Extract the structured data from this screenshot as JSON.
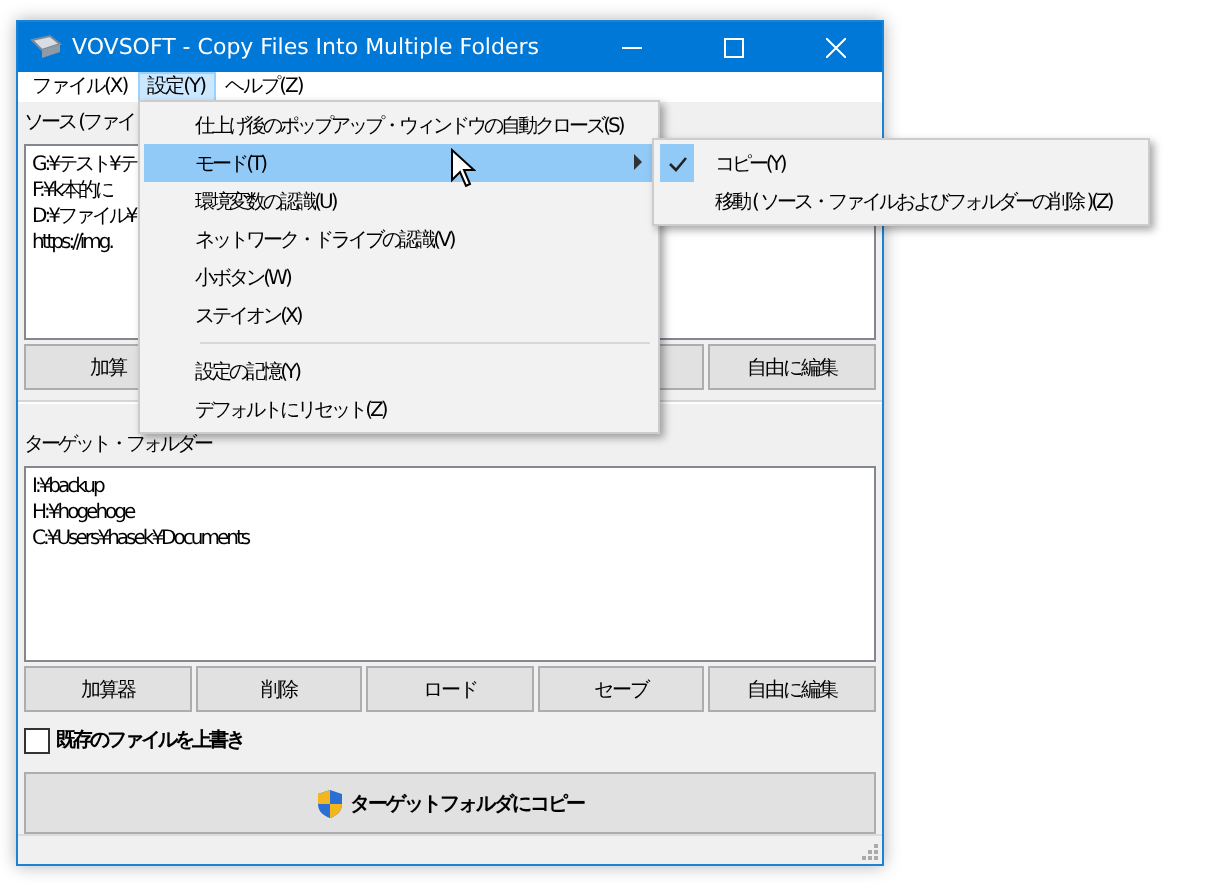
{
  "window": {
    "title": "VOVSOFT - Copy Files Into Multiple Folders"
  },
  "menu_bar": [
    {
      "label": "ファイル(X)",
      "selected": false
    },
    {
      "label": "設定(Y)",
      "selected": true
    },
    {
      "label": "ヘルプ(Z)",
      "selected": false
    }
  ],
  "source": {
    "label": "ソース (ファイ",
    "lines": [
      "G:¥テスト¥テ",
      "F:¥k本的に",
      "D:¥ファイル¥",
      "https://img."
    ],
    "buttons": [
      "加算",
      "自由に編集"
    ]
  },
  "target": {
    "label": "ターゲット・フォルダー",
    "lines": [
      "I:¥backup",
      "H:¥hogehoge",
      "C:¥Users¥hasek¥Documents"
    ],
    "buttons": [
      "加算器",
      "削除",
      "ロード",
      "セーブ",
      "自由に編集"
    ]
  },
  "overwrite": {
    "label": "既存のファイルを上書き",
    "checked": false
  },
  "copy_button": {
    "label": "ターゲットフォルダにコピー"
  },
  "settings_menu": {
    "items": [
      {
        "label": "仕上げ後のポップアップ・ウィンドウの自動クローズ(S)",
        "selected": false,
        "has_submenu": false,
        "separator_before": false
      },
      {
        "label": "モード(T)",
        "selected": true,
        "has_submenu": true,
        "separator_before": false
      },
      {
        "label": "環境変数の認識(U)",
        "selected": false,
        "has_submenu": false,
        "separator_before": false
      },
      {
        "label": "ネットワーク・ドライブの認識(V)",
        "selected": false,
        "has_submenu": false,
        "separator_before": false
      },
      {
        "label": "小ボタン(W)",
        "selected": false,
        "has_submenu": false,
        "separator_before": false
      },
      {
        "label": "ステイオン(X)",
        "selected": false,
        "has_submenu": false,
        "separator_before": false
      },
      {
        "label": "設定の記憶(Y)",
        "selected": false,
        "has_submenu": false,
        "separator_before": true
      },
      {
        "label": "デフォルトにリセット(Z)",
        "selected": false,
        "has_submenu": false,
        "separator_before": false
      }
    ]
  },
  "mode_submenu": {
    "items": [
      {
        "label": "コピー(Y)",
        "checked": true
      },
      {
        "label": "移動 ( ソース・ファイルおよびフォルダーの削除 )(Z)",
        "checked": false
      }
    ]
  }
}
